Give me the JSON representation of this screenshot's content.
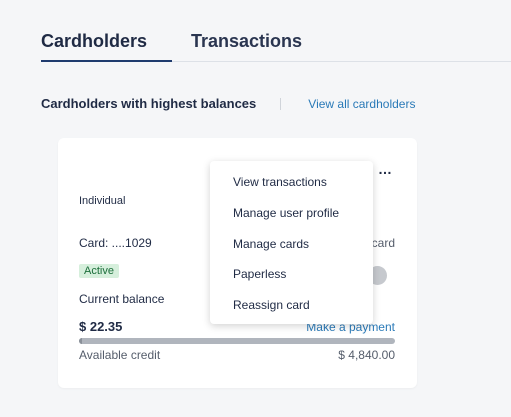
{
  "tabs": [
    {
      "label": "Cardholders",
      "active": true
    },
    {
      "label": "Transactions",
      "active": false
    }
  ],
  "section": {
    "title": "Cardholders with highest balances",
    "view_all": "View all cardholders"
  },
  "cardholder": {
    "type": "Individual",
    "card_number": "Card: ....1029",
    "card_partial": "card",
    "status": "Active",
    "current_balance_label": "Current balance",
    "current_balance": "$ 22.35",
    "make_payment": "Make a payment",
    "available_credit_label": "Available credit",
    "available_credit": "$ 4,840.00",
    "more_icon": "…"
  },
  "menu": {
    "items": [
      "View transactions",
      "Manage user profile",
      "Manage cards",
      "Paperless",
      "Reassign card"
    ]
  },
  "colors": {
    "accent": "#2a7ab8",
    "active_badge_bg": "#d6efdc",
    "active_badge_text": "#1b6e3a",
    "title": "#1f2a44"
  }
}
